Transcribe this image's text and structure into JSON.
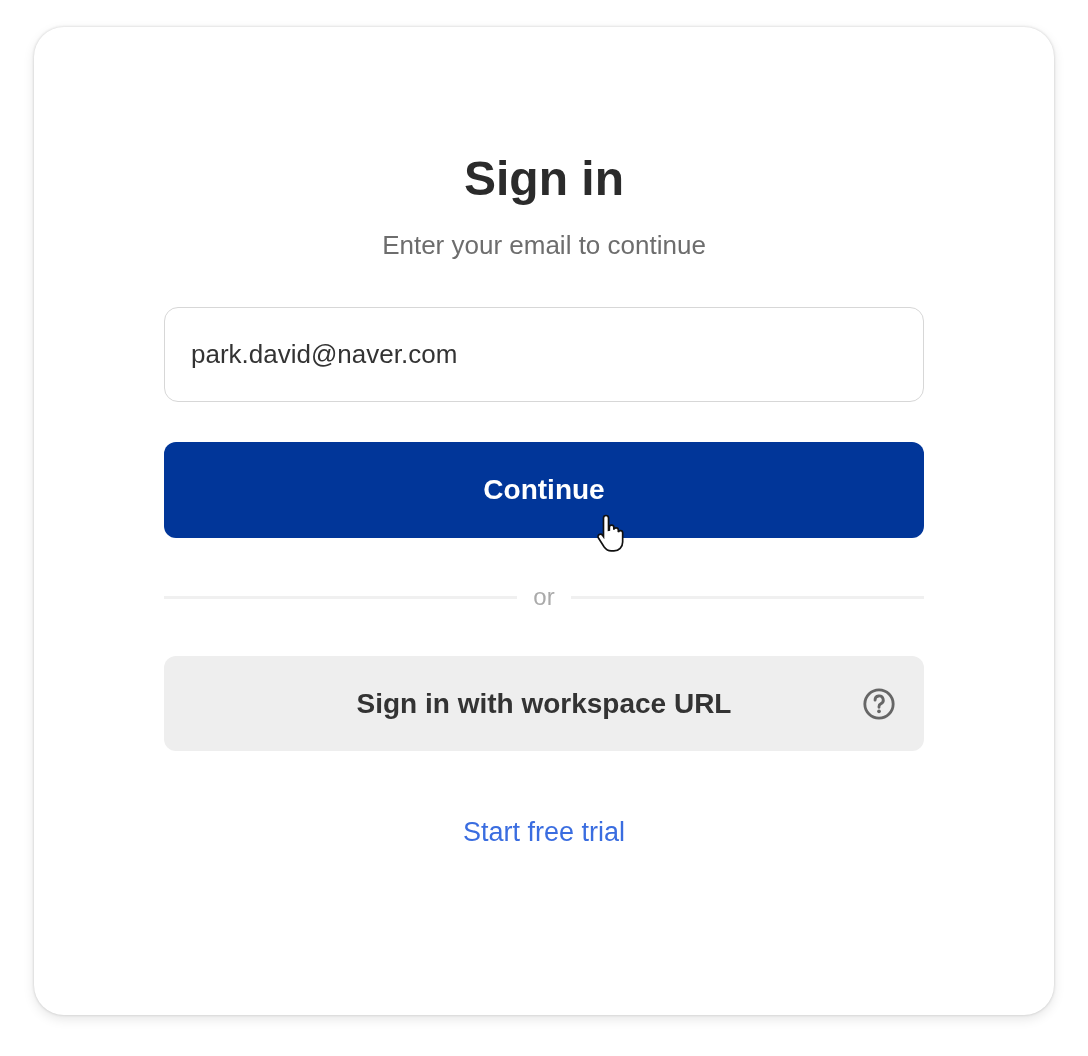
{
  "title": "Sign in",
  "subtitle": "Enter your email to continue",
  "email_field": {
    "value": "park.david@naver.com"
  },
  "continue_button": {
    "label": "Continue"
  },
  "divider": {
    "label": "or"
  },
  "workspace_button": {
    "label": "Sign in with workspace URL"
  },
  "trial_link": {
    "label": "Start free trial"
  }
}
